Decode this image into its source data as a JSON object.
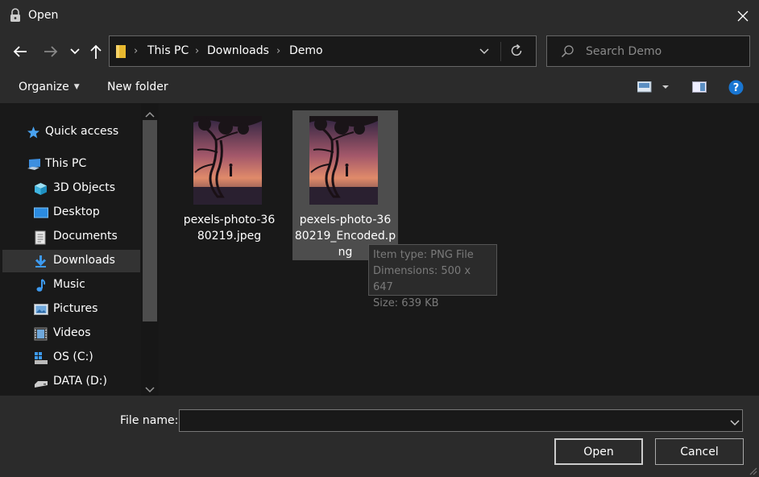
{
  "window": {
    "title": "Open",
    "close_icon": "close-icon",
    "title_icon": "lock-icon"
  },
  "navigation": {
    "back_icon": "arrow-left-icon",
    "forward_icon": "arrow-right-icon",
    "recent_icon": "chevron-down-icon",
    "up_icon": "arrow-up-icon"
  },
  "address": {
    "crumbs": [
      "This PC",
      "Downloads",
      "Demo"
    ],
    "separator": "›",
    "refresh_icon": "refresh-icon"
  },
  "search": {
    "placeholder": "Search Demo"
  },
  "toolbar": {
    "organize_label": "Organize",
    "new_folder_label": "New folder",
    "view_icon": "view-icon",
    "preview_pane_icon": "preview-pane-icon",
    "help_icon": "help-icon"
  },
  "sidebar": {
    "items": [
      {
        "label": "Quick access",
        "icon": "star-icon"
      },
      {
        "label": "This PC",
        "icon": "computer-icon"
      },
      {
        "label": "3D Objects",
        "icon": "cube-icon"
      },
      {
        "label": "Desktop",
        "icon": "desktop-icon"
      },
      {
        "label": "Documents",
        "icon": "document-icon"
      },
      {
        "label": "Downloads",
        "icon": "download-icon",
        "selected": true
      },
      {
        "label": "Music",
        "icon": "music-icon"
      },
      {
        "label": "Pictures",
        "icon": "pictures-icon"
      },
      {
        "label": "Videos",
        "icon": "video-icon"
      },
      {
        "label": "OS (C:)",
        "icon": "windows-drive-icon"
      },
      {
        "label": "DATA (D:)",
        "icon": "drive-icon"
      }
    ]
  },
  "files": [
    {
      "name": "pexels-photo-3680219.jpeg",
      "line1": "pexels-photo-36",
      "line2": "80219.jpeg",
      "line3": ""
    },
    {
      "name": "pexels-photo-3680219_Encoded.png",
      "line1": "pexels-photo-36",
      "line2": "80219_Encoded.p",
      "line3": "ng",
      "hovered": true
    }
  ],
  "tooltip": {
    "type": "Item type: PNG File",
    "dimensions": "Dimensions: 500 x 647",
    "size": "Size: 639 KB"
  },
  "footer": {
    "file_name_label": "File name:",
    "file_name_value": "",
    "open_label": "Open",
    "cancel_label": "Cancel"
  },
  "colors": {
    "background": "#191919",
    "chrome": "#2b2b2b",
    "selection": "#333333",
    "hover": "#4d4d4d",
    "accent_blue": "#1e90ff"
  }
}
